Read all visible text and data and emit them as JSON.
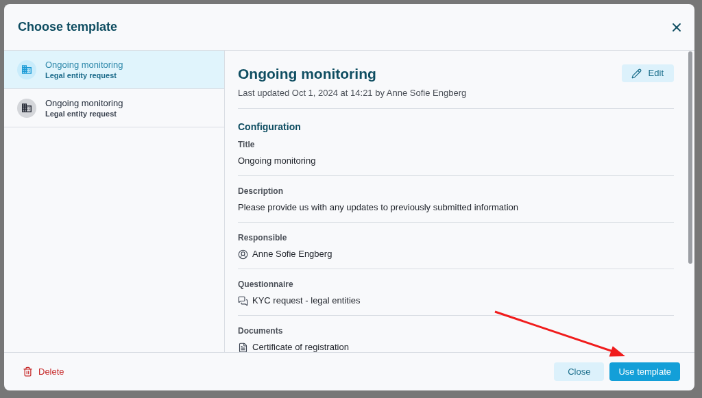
{
  "dialog": {
    "title": "Choose template"
  },
  "templates": [
    {
      "name": "Ongoing monitoring",
      "type": "Legal entity request",
      "selected": true
    },
    {
      "name": "Ongoing monitoring",
      "type": "Legal entity request",
      "selected": false
    }
  ],
  "detail": {
    "title": "Ongoing monitoring",
    "updated": "Last updated Oct 1, 2024 at 14:21 by Anne Sofie Engberg",
    "edit_label": "Edit",
    "section": "Configuration",
    "fields": [
      {
        "label": "Title",
        "value": "Ongoing monitoring",
        "kind": "text"
      },
      {
        "label": "Description",
        "value": "Please provide us with any updates to previously submitted information",
        "kind": "text"
      },
      {
        "label": "Responsible",
        "value": "Anne Sofie Engberg",
        "kind": "person"
      },
      {
        "label": "Questionnaire",
        "value": "KYC request - legal entities",
        "kind": "questionnaire"
      },
      {
        "label": "Documents",
        "value": "Certificate of registration",
        "kind": "document"
      }
    ]
  },
  "footer": {
    "delete_label": "Delete",
    "buttons": [
      {
        "label": "Close",
        "kind": "secondary"
      },
      {
        "label": "Use template",
        "kind": "primary"
      }
    ]
  }
}
